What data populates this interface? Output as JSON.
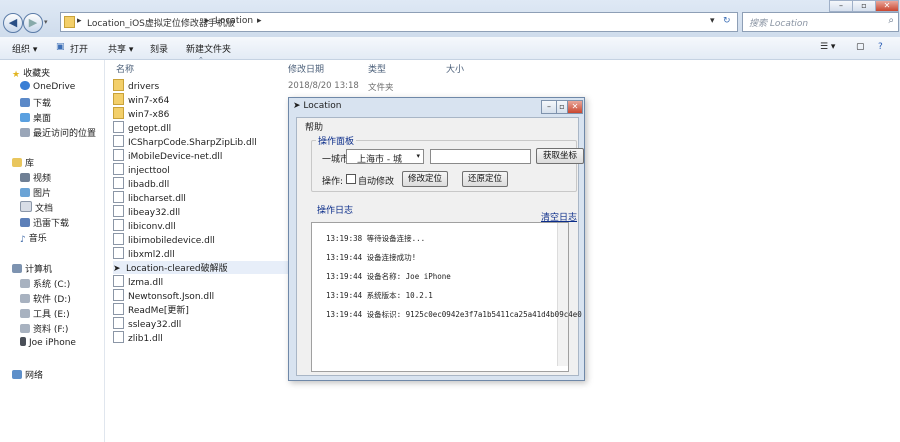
{
  "address_bar": {
    "segments": [
      "Location_iOS虚拟定位修改器手机版",
      "Location"
    ],
    "search_placeholder": "搜索 Location"
  },
  "toolbar": {
    "organize": "组织 ▾",
    "open": "打开",
    "share": "共享 ▾",
    "burn": "刻录",
    "new_folder": "新建文件夹"
  },
  "nav_pane": {
    "favorites": "收藏夹",
    "onedrive": "OneDrive",
    "downloads": "下载",
    "desktop": "桌面",
    "recent": "最近访问的位置",
    "libraries": "库",
    "videos": "视频",
    "pictures": "图片",
    "documents": "文档",
    "thunder": "迅雷下载",
    "music": "音乐",
    "computer": "计算机",
    "drive_c": "系统 (C:)",
    "drive_d": "软件 (D:)",
    "drive_e": "工具 (E:)",
    "drive_f": "资料 (F:)",
    "iphone": "Joe iPhone",
    "network": "网络"
  },
  "columns": {
    "name": "名称",
    "date": "修改日期",
    "type": "类型",
    "size": "大小"
  },
  "files": [
    {
      "name": "drivers",
      "kind": "folder",
      "date": "2018/8/20 13:18",
      "type": "文件夹"
    },
    {
      "name": "win7-x64",
      "kind": "folder"
    },
    {
      "name": "win7-x86",
      "kind": "folder"
    },
    {
      "name": "getopt.dll",
      "kind": "file"
    },
    {
      "name": "ICSharpCode.SharpZipLib.dll",
      "kind": "file"
    },
    {
      "name": "iMobileDevice-net.dll",
      "kind": "file"
    },
    {
      "name": "injecttool",
      "kind": "file"
    },
    {
      "name": "libadb.dll",
      "kind": "file"
    },
    {
      "name": "libcharset.dll",
      "kind": "file"
    },
    {
      "name": "libeay32.dll",
      "kind": "file"
    },
    {
      "name": "libiconv.dll",
      "kind": "file"
    },
    {
      "name": "libimobiledevice.dll",
      "kind": "file"
    },
    {
      "name": "libxml2.dll",
      "kind": "file"
    },
    {
      "name": "Location-cleared破解版",
      "kind": "app",
      "selected": true
    },
    {
      "name": "lzma.dll",
      "kind": "file"
    },
    {
      "name": "Newtonsoft.Json.dll",
      "kind": "file"
    },
    {
      "name": "ReadMe[更新]",
      "kind": "file"
    },
    {
      "name": "ssleay32.dll",
      "kind": "file"
    },
    {
      "name": "zlib1.dll",
      "kind": "file"
    }
  ],
  "dialog": {
    "title": "Location",
    "menu_help": "帮助",
    "group_ops": "操作面板",
    "city_label": "一城市:",
    "city_select": "上海市 - 城",
    "coord_placeholder": "",
    "search_button": "获取坐标",
    "options_label": "操作:",
    "checkbox_label": "自动修改",
    "modify_button": "修改定位",
    "restore_button": "还原定位",
    "group_log": "操作日志",
    "clear_log": "清空日志",
    "log_lines": [
      "13:19:38 等待设备连接...",
      "13:19:44 设备连接成功!",
      "13:19:44 设备名称: Joe iPhone",
      "13:19:44 系统版本: 10.2.1",
      "13:19:44 设备标识: 9125c0ec0942e3f7a1b5411ca25a41d4b09c4e0"
    ]
  }
}
